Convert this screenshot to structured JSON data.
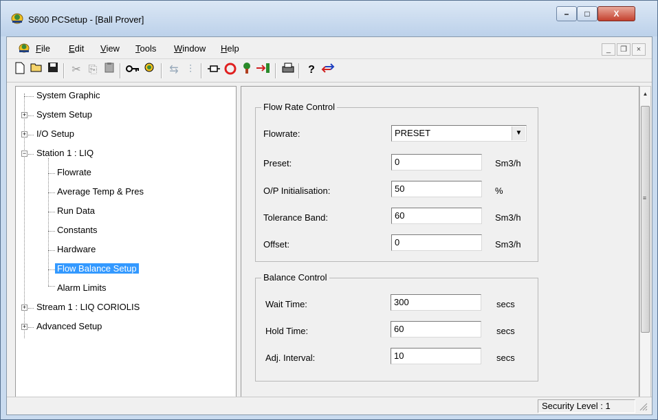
{
  "window": {
    "title": "S600 PCSetup - [Ball Prover]",
    "app_icon": "s600-app-icon"
  },
  "caption_buttons": {
    "minimize": "–",
    "maximize": "□",
    "close": "X"
  },
  "menu": {
    "items": [
      {
        "label": "File",
        "accel": "F",
        "rest": "ile"
      },
      {
        "label": "Edit",
        "accel": "E",
        "rest": "dit"
      },
      {
        "label": "View",
        "accel": "V",
        "rest": "iew"
      },
      {
        "label": "Tools",
        "accel": "T",
        "rest": "ools"
      },
      {
        "label": "Window",
        "accel": "W",
        "rest": "indow"
      },
      {
        "label": "Help",
        "accel": "H",
        "rest": "elp"
      }
    ]
  },
  "mdi_buttons": {
    "minimize": "_",
    "restore": "❐",
    "close": "×"
  },
  "toolbar": {
    "icons": [
      "new-icon",
      "open-icon",
      "save-icon",
      "cut-icon",
      "copy-icon",
      "paste-icon",
      "key-icon",
      "find-icon",
      "connect-icon",
      "tune-icon",
      "port-icon",
      "stop-icon",
      "upload-icon",
      "download-icon",
      "print-icon",
      "help-icon",
      "transfer-icon"
    ]
  },
  "tree": {
    "items": [
      "System Graphic",
      "System Setup",
      "I/O Setup",
      "Station 1 : LIQ",
      "Flowrate",
      "Average Temp & Pres",
      "Run Data",
      "Constants",
      "Hardware",
      "Flow Balance Setup",
      "Alarm Limits",
      "Stream 1 : LIQ CORIOLIS",
      "Advanced Setup"
    ],
    "selected": "Flow Balance Setup"
  },
  "flow_rate_control": {
    "title": "Flow Rate Control",
    "flowrate": {
      "label": "Flowrate:",
      "value": "PRESET"
    },
    "preset": {
      "label": "Preset:",
      "value": "0",
      "unit": "Sm3/h"
    },
    "op_init": {
      "label": "O/P Initialisation:",
      "value": "50",
      "unit": "%"
    },
    "tolerance": {
      "label": "Tolerance Band:",
      "value": "60",
      "unit": "Sm3/h"
    },
    "offset": {
      "label": "Offset:",
      "value": "0",
      "unit": "Sm3/h"
    }
  },
  "balance_control": {
    "title": "Balance Control",
    "wait_time": {
      "label": "Wait Time:",
      "value": "300",
      "unit": "secs"
    },
    "hold_time": {
      "label": "Hold Time:",
      "value": "60",
      "unit": "secs"
    },
    "adj_interval": {
      "label": "Adj. Interval:",
      "value": "10",
      "unit": "secs"
    }
  },
  "status": {
    "security": "Security Level : 1"
  }
}
